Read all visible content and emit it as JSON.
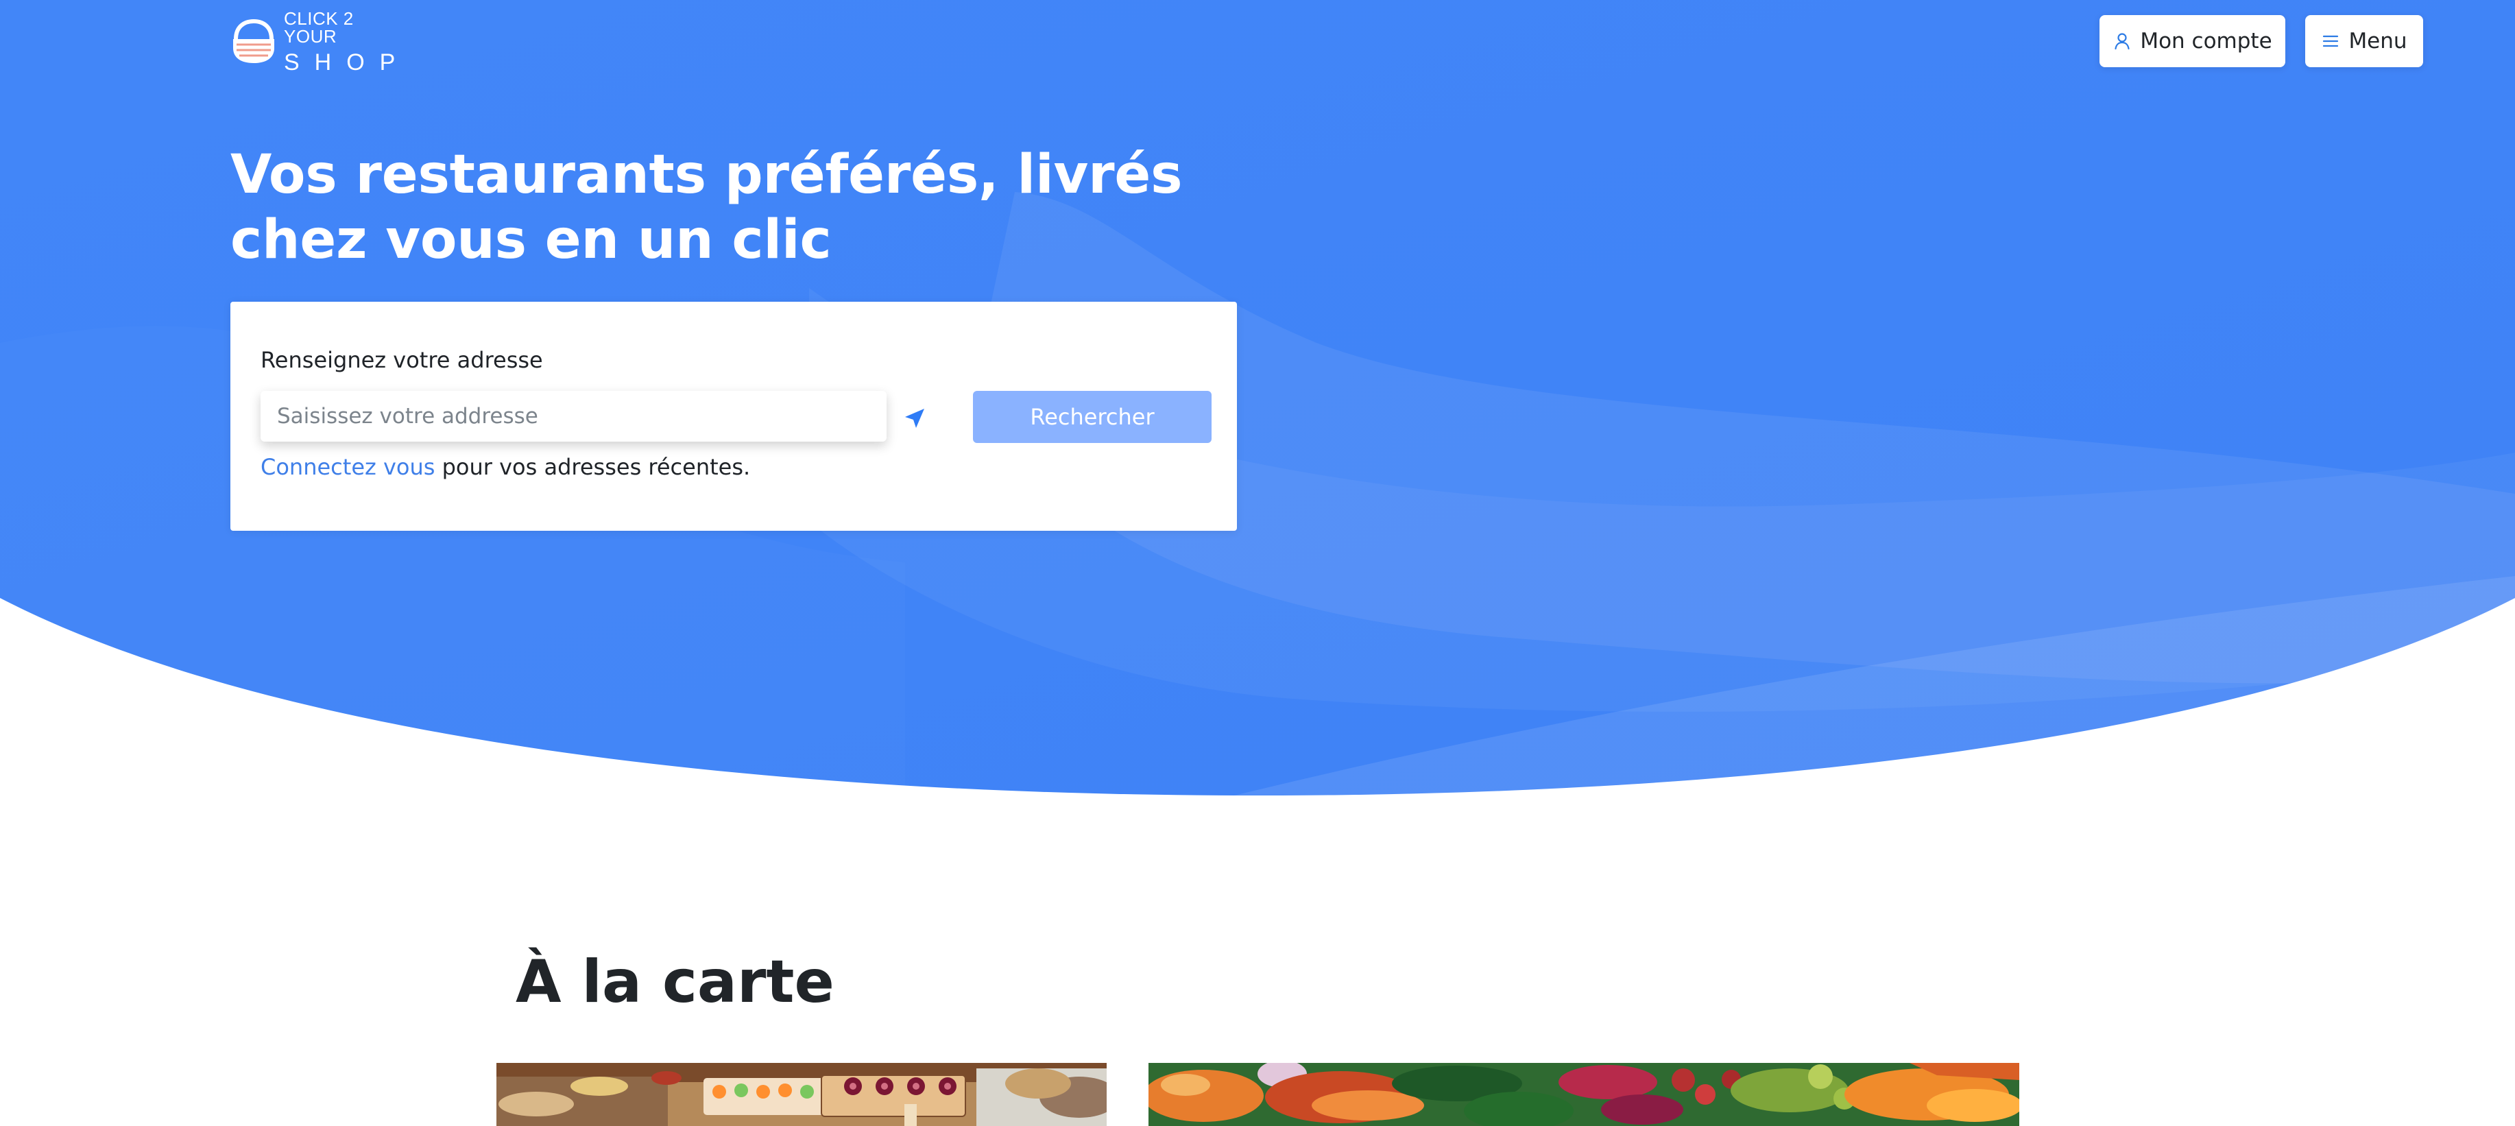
{
  "header": {
    "logo": {
      "line1": "CLICK 2 YOUR",
      "line2": "SHOP"
    },
    "account_label": "Mon compte",
    "menu_label": "Menu",
    "icons": {
      "account": "user-icon",
      "menu": "hamburger-menu-icon",
      "logo": "basket-logo-icon"
    }
  },
  "hero": {
    "title": "Vos restaurants préférés, livrés chez vous en un clic",
    "background_color": "#4184f8"
  },
  "search": {
    "label": "Renseignez votre adresse",
    "input_placeholder": "Saisissez votre addresse",
    "input_value": "",
    "locate_icon": "location-arrow-icon",
    "button_label": "Rechercher",
    "link_text": "Connectez vous",
    "link_suffix": " pour vos adresses récentes."
  },
  "catalogue": {
    "title": "À la carte",
    "cards": [
      {
        "name": "food-platter-image"
      },
      {
        "name": "roasted-vegetables-salad-image"
      }
    ]
  },
  "colors": {
    "accent": "#4184f8",
    "button_disabled": "#8ab2ff",
    "link": "#3f7fe8",
    "text": "#212529"
  }
}
